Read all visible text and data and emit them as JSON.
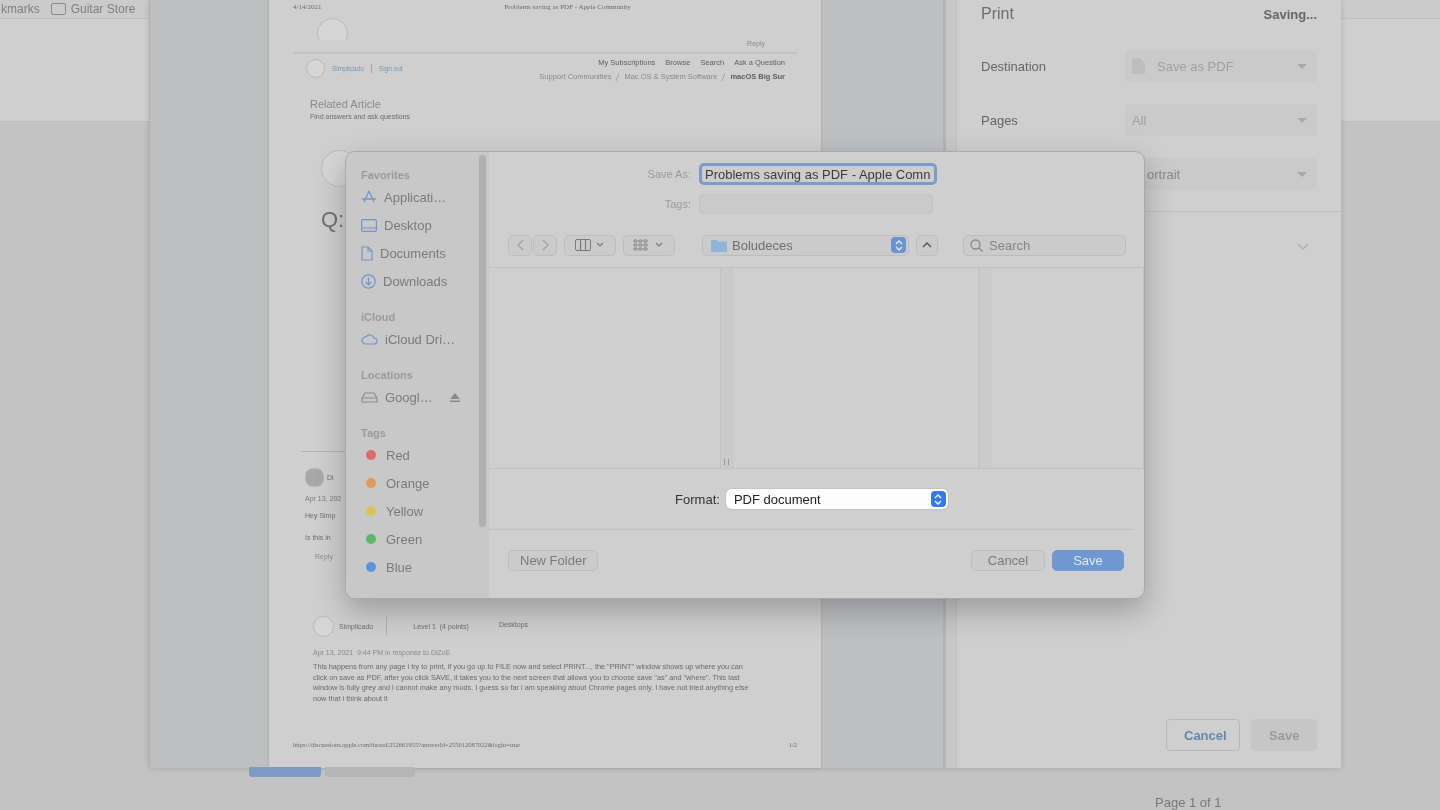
{
  "browser": {
    "bookmarks": [
      {
        "label": "kmarks",
        "kind": "text"
      },
      {
        "label": "Guitar Store",
        "kind": "folder"
      }
    ]
  },
  "preview": {
    "header": {
      "date": "4/14/2021",
      "title": "Problems saving as PDF - Apple Community"
    },
    "reply_link": "Reply",
    "nav": {
      "user": "Simplicado",
      "sign_out": "Sign out",
      "links": [
        "My Subscriptions",
        "Browse",
        "Search",
        "Ask a Question"
      ],
      "breadcrumbs": [
        "Support Communities",
        "Mac OS & System Software",
        "macOS Big Sur"
      ]
    },
    "related": {
      "title": "Related Article",
      "subtitle": "Find answers and ask questions"
    },
    "question_mark": "Q:",
    "reply_post": {
      "author": "Di",
      "date": "Apr 13, 202",
      "line_1": "Hey Simp",
      "line_2": "Is this in",
      "reply": "Reply"
    },
    "post": {
      "author": "Simplicado",
      "level": "Level 1  (4 points)",
      "category": "Desktops",
      "date": "Apr 13, 2021  9:44 PM in response to DiZoE",
      "body": "This happens from any page i try to print, if you go up to FILE now and select PRINT..., the \"PRINT\" window shows up where you can click on save as PDF, after you click SAVE, it takes you to the next screen that allows you to choose save \"as\" and \"where\". This last window is fully grey and i cannot make any mods. I guess so far i am speaking about Chrome pages only. I have not tried anything else now that i think about it"
    },
    "footer": {
      "url": "https://discussions.apple.com/thread/252661955?answerId=255012087022&login=true",
      "page": "1/2"
    }
  },
  "print_panel": {
    "title": "Print",
    "status": "Saving...",
    "settings": [
      {
        "kind": "select",
        "label": "Destination",
        "value": "Save as PDF",
        "file_icon": true
      },
      {
        "kind": "select",
        "label": "Pages",
        "value": "All",
        "file_icon": false
      },
      {
        "kind": "select",
        "value": "ortrait",
        "file_icon": false
      },
      {
        "kind": "expander"
      }
    ],
    "buttons": [
      {
        "label": "Cancel",
        "kind": "secondary"
      },
      {
        "label": "Save",
        "kind": "primary"
      }
    ],
    "page_count": "Page 1 of 1"
  },
  "save_dialog": {
    "sidebar": [
      {
        "heading": "Favorites",
        "items": [
          {
            "label": "Applicati…",
            "kind": "apps"
          },
          {
            "label": "Desktop",
            "kind": "desktop"
          },
          {
            "label": "Documents",
            "kind": "document"
          },
          {
            "label": "Downloads",
            "kind": "download"
          }
        ]
      },
      {
        "heading": "iCloud",
        "items": [
          {
            "label": "iCloud Dri…",
            "kind": "cloud"
          }
        ]
      },
      {
        "heading": "Locations",
        "items": [
          {
            "label": "Googl…",
            "kind": "drive",
            "eject": true
          }
        ]
      },
      {
        "heading": "Tags",
        "items": [
          {
            "label": "Red",
            "kind": "tag",
            "color": "#e06a6a"
          },
          {
            "label": "Orange",
            "kind": "tag",
            "color": "#e09a5a"
          },
          {
            "label": "Yellow",
            "kind": "tag",
            "color": "#dcc25a"
          },
          {
            "label": "Green",
            "kind": "tag",
            "color": "#5ab86a"
          },
          {
            "label": "Blue",
            "kind": "tag",
            "color": "#5a94e0"
          }
        ]
      }
    ],
    "save_as": {
      "label": "Save As:",
      "value": "Problems saving as PDF - Apple Comn"
    },
    "tags": {
      "label": "Tags:"
    },
    "location": "Boludeces",
    "search": {
      "placeholder": "Search"
    },
    "format": {
      "label": "Format:",
      "value": "PDF document"
    },
    "buttons": [
      {
        "label": "New Folder",
        "kind": "plain"
      },
      {
        "label": "Cancel",
        "kind": "secondary"
      },
      {
        "label": "Save",
        "kind": "primary"
      }
    ]
  }
}
